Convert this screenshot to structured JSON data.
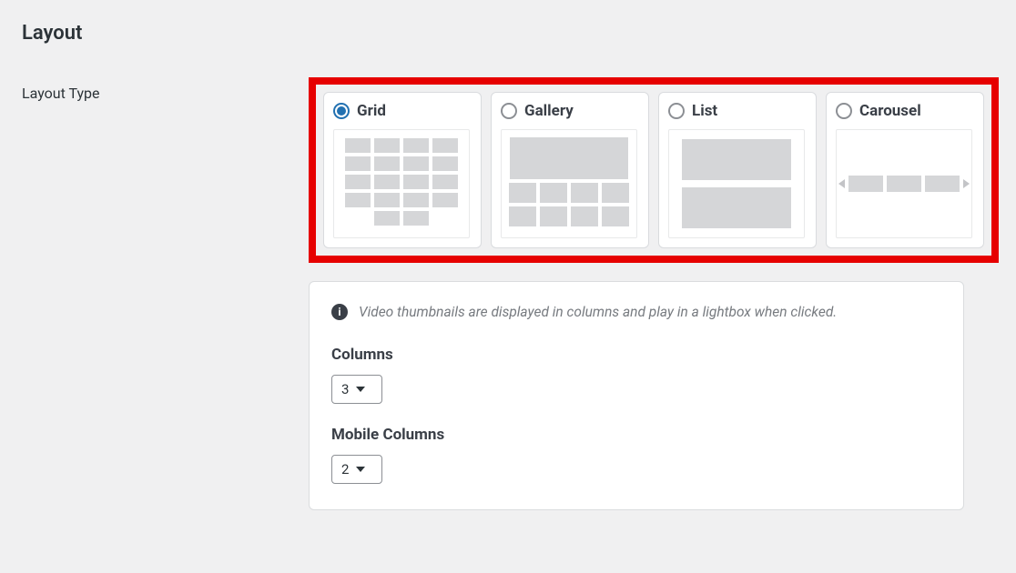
{
  "section_title": "Layout",
  "layout_type": {
    "label": "Layout Type",
    "selected": "grid",
    "options": {
      "grid": "Grid",
      "gallery": "Gallery",
      "list": "List",
      "carousel": "Carousel"
    }
  },
  "info_text": "Video thumbnails are displayed in columns and play in a lightbox when clicked.",
  "columns": {
    "label": "Columns",
    "value": "3"
  },
  "mobile_columns": {
    "label": "Mobile Columns",
    "value": "2"
  }
}
